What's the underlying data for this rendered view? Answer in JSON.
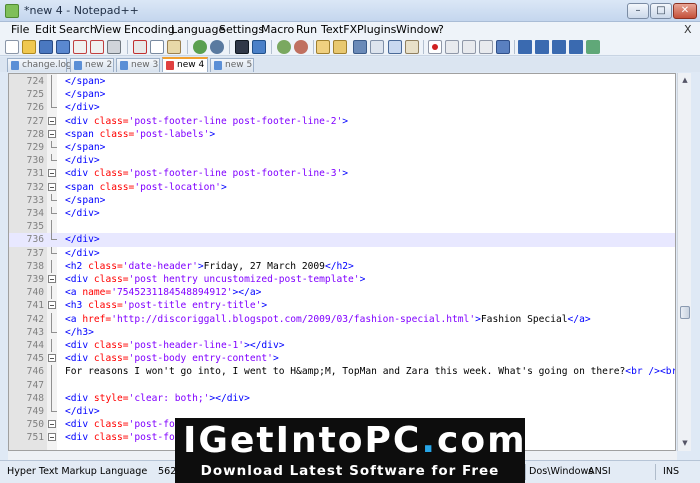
{
  "window": {
    "title": "*new 4 - Notepad++",
    "minimize_label": "–",
    "maximize_label": "□",
    "close_label": "✕"
  },
  "menu": {
    "items": [
      "File",
      "Edit",
      "Search",
      "View",
      "Encoding",
      "Language",
      "Settings",
      "Macro",
      "Run",
      "TextFX",
      "Plugins",
      "Window",
      "?"
    ],
    "close_glyph": "X"
  },
  "toolbar": {
    "icons": [
      "new-file",
      "open",
      "save",
      "save-all",
      "close",
      "close-all",
      "print",
      "cut",
      "copy",
      "paste",
      "undo",
      "redo",
      "find",
      "replace",
      "zoom-in",
      "zoom-out",
      "sync-vertical",
      "sync-horizontal",
      "word-wrap",
      "show-all-chars",
      "indent-guide",
      "user-defined-dialog",
      "record-macro",
      "stop-recording",
      "playback",
      "run-macro-multiple",
      "save-macro",
      "trim",
      "move-up",
      "move-down",
      "sort",
      "spellcheck"
    ]
  },
  "tabs": [
    {
      "label": "change.log",
      "active": false,
      "icon_color": "#5b8fd6"
    },
    {
      "label": "new  2",
      "active": false,
      "icon_color": "#5b8fd6"
    },
    {
      "label": "new  3",
      "active": false,
      "icon_color": "#5b8fd6"
    },
    {
      "label": "new  4",
      "active": true,
      "icon_color": "#e04040"
    },
    {
      "label": "new  5",
      "active": false,
      "icon_color": "#5b8fd6"
    }
  ],
  "editor": {
    "current_line": "736",
    "lines": [
      {
        "n": "724",
        "fold": "line",
        "tokens": [
          [
            "tag",
            "</span>"
          ]
        ]
      },
      {
        "n": "725",
        "fold": "line",
        "tokens": [
          [
            "tag",
            "</span>"
          ]
        ]
      },
      {
        "n": "726",
        "fold": "end",
        "tokens": [
          [
            "tag",
            "</div>"
          ]
        ]
      },
      {
        "n": "727",
        "fold": "box",
        "tokens": [
          [
            "tag",
            "<div "
          ],
          [
            "attr",
            "class="
          ],
          [
            "val",
            "'post-footer-line post-footer-line-2'"
          ],
          [
            "tag",
            ">"
          ]
        ]
      },
      {
        "n": "728",
        "fold": "box",
        "tokens": [
          [
            "tag",
            "<span "
          ],
          [
            "attr",
            "class="
          ],
          [
            "val",
            "'post-labels'"
          ],
          [
            "tag",
            ">"
          ]
        ]
      },
      {
        "n": "729",
        "fold": "end",
        "tokens": [
          [
            "tag",
            "</span>"
          ]
        ]
      },
      {
        "n": "730",
        "fold": "end",
        "tokens": [
          [
            "tag",
            "</div>"
          ]
        ]
      },
      {
        "n": "731",
        "fold": "box",
        "tokens": [
          [
            "tag",
            "<div "
          ],
          [
            "attr",
            "class="
          ],
          [
            "val",
            "'post-footer-line post-footer-line-3'"
          ],
          [
            "tag",
            ">"
          ]
        ]
      },
      {
        "n": "732",
        "fold": "box",
        "tokens": [
          [
            "tag",
            "<span "
          ],
          [
            "attr",
            "class="
          ],
          [
            "val",
            "'post-location'"
          ],
          [
            "tag",
            ">"
          ]
        ]
      },
      {
        "n": "733",
        "fold": "end",
        "tokens": [
          [
            "tag",
            "</span>"
          ]
        ]
      },
      {
        "n": "734",
        "fold": "end",
        "tokens": [
          [
            "tag",
            "</div>"
          ]
        ]
      },
      {
        "n": "735",
        "fold": "line",
        "tokens": []
      },
      {
        "n": "736",
        "fold": "end",
        "tokens": [
          [
            "tag",
            "</div>"
          ]
        ]
      },
      {
        "n": "737",
        "fold": "end",
        "tokens": [
          [
            "tag",
            "</div>"
          ]
        ]
      },
      {
        "n": "738",
        "fold": "line",
        "tokens": [
          [
            "tag",
            "<h2 "
          ],
          [
            "attr",
            "class="
          ],
          [
            "val",
            "'date-header'"
          ],
          [
            "tag",
            ">"
          ],
          [
            "txt",
            "Friday, 27 March 2009"
          ],
          [
            "tag",
            "</h2>"
          ]
        ]
      },
      {
        "n": "739",
        "fold": "box",
        "tokens": [
          [
            "tag",
            "<div "
          ],
          [
            "attr",
            "class="
          ],
          [
            "val",
            "'post hentry uncustomized-post-template'"
          ],
          [
            "tag",
            ">"
          ]
        ]
      },
      {
        "n": "740",
        "fold": "line",
        "tokens": [
          [
            "tag",
            "<a "
          ],
          [
            "attr",
            "name="
          ],
          [
            "val",
            "'7545231184548894912'"
          ],
          [
            "tag",
            "></a>"
          ]
        ]
      },
      {
        "n": "741",
        "fold": "box",
        "tokens": [
          [
            "tag",
            "<h3 "
          ],
          [
            "attr",
            "class="
          ],
          [
            "val",
            "'post-title entry-title'"
          ],
          [
            "tag",
            ">"
          ]
        ]
      },
      {
        "n": "742",
        "fold": "line",
        "tokens": [
          [
            "tag",
            "<a "
          ],
          [
            "attr",
            "href="
          ],
          [
            "val",
            "'http://discoriggall.blogspot.com/2009/03/fashion-special.html'"
          ],
          [
            "tag",
            ">"
          ],
          [
            "txt",
            "Fashion Special"
          ],
          [
            "tag",
            "</a>"
          ]
        ]
      },
      {
        "n": "743",
        "fold": "end",
        "tokens": [
          [
            "tag",
            "</h3>"
          ]
        ]
      },
      {
        "n": "744",
        "fold": "line",
        "tokens": [
          [
            "tag",
            "<div "
          ],
          [
            "attr",
            "class="
          ],
          [
            "val",
            "'post-header-line-1'"
          ],
          [
            "tag",
            "></div>"
          ]
        ]
      },
      {
        "n": "745",
        "fold": "box",
        "tokens": [
          [
            "tag",
            "<div "
          ],
          [
            "attr",
            "class="
          ],
          [
            "val",
            "'post-body entry-content'"
          ],
          [
            "tag",
            ">"
          ]
        ]
      },
      {
        "n": "746",
        "fold": "line",
        "tokens": [
          [
            "txt",
            "For reasons I won't go into, I went to H"
          ],
          [
            "ent",
            "&amp;"
          ],
          [
            "txt",
            "M, TopMan and Zara this week. What's going on there?"
          ],
          [
            "tag",
            "<br />"
          ],
          [
            "tag",
            "<br"
          ]
        ]
      },
      {
        "n": "747",
        "fold": "line",
        "tokens": []
      },
      {
        "n": "748",
        "fold": "line",
        "tokens": [
          [
            "tag",
            "<div "
          ],
          [
            "attr",
            "style="
          ],
          [
            "val",
            "'clear: both;'"
          ],
          [
            "tag",
            "></div>"
          ]
        ]
      },
      {
        "n": "749",
        "fold": "end",
        "tokens": [
          [
            "tag",
            "</div>"
          ]
        ]
      },
      {
        "n": "750",
        "fold": "box",
        "tokens": [
          [
            "tag",
            "<div "
          ],
          [
            "attr",
            "class="
          ],
          [
            "val",
            "'post-foot"
          ]
        ]
      },
      {
        "n": "751",
        "fold": "box",
        "tokens": [
          [
            "tag",
            "<div "
          ],
          [
            "attr",
            "class="
          ],
          [
            "val",
            "'post-foot"
          ]
        ]
      }
    ]
  },
  "statusbar": {
    "language": "Hyper Text Markup Language",
    "chars": "56265 chars",
    "eol": "Dos\\Windows",
    "encoding": "ANSI",
    "mode": "INS"
  },
  "watermark": {
    "logo_main": "IGetIntoPC",
    "logo_dot": ".",
    "logo_tld": "com",
    "tagline": "Download Latest Software for Free"
  },
  "colors": {
    "tag": "#0000ff",
    "attr": "#ff0000",
    "val": "#8000ff",
    "text": "#000000",
    "current_line_bg": "#e8e8ff",
    "watermark_accent": "#27a6e8"
  }
}
